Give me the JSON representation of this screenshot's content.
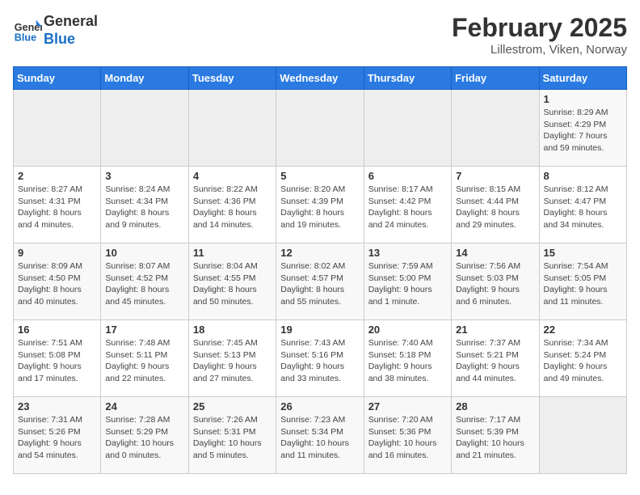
{
  "header": {
    "logo_line1": "General",
    "logo_line2": "Blue",
    "title": "February 2025",
    "subtitle": "Lillestrom, Viken, Norway"
  },
  "weekdays": [
    "Sunday",
    "Monday",
    "Tuesday",
    "Wednesday",
    "Thursday",
    "Friday",
    "Saturday"
  ],
  "weeks": [
    [
      {
        "day": "",
        "info": ""
      },
      {
        "day": "",
        "info": ""
      },
      {
        "day": "",
        "info": ""
      },
      {
        "day": "",
        "info": ""
      },
      {
        "day": "",
        "info": ""
      },
      {
        "day": "",
        "info": ""
      },
      {
        "day": "1",
        "info": "Sunrise: 8:29 AM\nSunset: 4:29 PM\nDaylight: 7 hours and 59 minutes."
      }
    ],
    [
      {
        "day": "2",
        "info": "Sunrise: 8:27 AM\nSunset: 4:31 PM\nDaylight: 8 hours and 4 minutes."
      },
      {
        "day": "3",
        "info": "Sunrise: 8:24 AM\nSunset: 4:34 PM\nDaylight: 8 hours and 9 minutes."
      },
      {
        "day": "4",
        "info": "Sunrise: 8:22 AM\nSunset: 4:36 PM\nDaylight: 8 hours and 14 minutes."
      },
      {
        "day": "5",
        "info": "Sunrise: 8:20 AM\nSunset: 4:39 PM\nDaylight: 8 hours and 19 minutes."
      },
      {
        "day": "6",
        "info": "Sunrise: 8:17 AM\nSunset: 4:42 PM\nDaylight: 8 hours and 24 minutes."
      },
      {
        "day": "7",
        "info": "Sunrise: 8:15 AM\nSunset: 4:44 PM\nDaylight: 8 hours and 29 minutes."
      },
      {
        "day": "8",
        "info": "Sunrise: 8:12 AM\nSunset: 4:47 PM\nDaylight: 8 hours and 34 minutes."
      }
    ],
    [
      {
        "day": "9",
        "info": "Sunrise: 8:09 AM\nSunset: 4:50 PM\nDaylight: 8 hours and 40 minutes."
      },
      {
        "day": "10",
        "info": "Sunrise: 8:07 AM\nSunset: 4:52 PM\nDaylight: 8 hours and 45 minutes."
      },
      {
        "day": "11",
        "info": "Sunrise: 8:04 AM\nSunset: 4:55 PM\nDaylight: 8 hours and 50 minutes."
      },
      {
        "day": "12",
        "info": "Sunrise: 8:02 AM\nSunset: 4:57 PM\nDaylight: 8 hours and 55 minutes."
      },
      {
        "day": "13",
        "info": "Sunrise: 7:59 AM\nSunset: 5:00 PM\nDaylight: 9 hours and 1 minute."
      },
      {
        "day": "14",
        "info": "Sunrise: 7:56 AM\nSunset: 5:03 PM\nDaylight: 9 hours and 6 minutes."
      },
      {
        "day": "15",
        "info": "Sunrise: 7:54 AM\nSunset: 5:05 PM\nDaylight: 9 hours and 11 minutes."
      }
    ],
    [
      {
        "day": "16",
        "info": "Sunrise: 7:51 AM\nSunset: 5:08 PM\nDaylight: 9 hours and 17 minutes."
      },
      {
        "day": "17",
        "info": "Sunrise: 7:48 AM\nSunset: 5:11 PM\nDaylight: 9 hours and 22 minutes."
      },
      {
        "day": "18",
        "info": "Sunrise: 7:45 AM\nSunset: 5:13 PM\nDaylight: 9 hours and 27 minutes."
      },
      {
        "day": "19",
        "info": "Sunrise: 7:43 AM\nSunset: 5:16 PM\nDaylight: 9 hours and 33 minutes."
      },
      {
        "day": "20",
        "info": "Sunrise: 7:40 AM\nSunset: 5:18 PM\nDaylight: 9 hours and 38 minutes."
      },
      {
        "day": "21",
        "info": "Sunrise: 7:37 AM\nSunset: 5:21 PM\nDaylight: 9 hours and 44 minutes."
      },
      {
        "day": "22",
        "info": "Sunrise: 7:34 AM\nSunset: 5:24 PM\nDaylight: 9 hours and 49 minutes."
      }
    ],
    [
      {
        "day": "23",
        "info": "Sunrise: 7:31 AM\nSunset: 5:26 PM\nDaylight: 9 hours and 54 minutes."
      },
      {
        "day": "24",
        "info": "Sunrise: 7:28 AM\nSunset: 5:29 PM\nDaylight: 10 hours and 0 minutes."
      },
      {
        "day": "25",
        "info": "Sunrise: 7:26 AM\nSunset: 5:31 PM\nDaylight: 10 hours and 5 minutes."
      },
      {
        "day": "26",
        "info": "Sunrise: 7:23 AM\nSunset: 5:34 PM\nDaylight: 10 hours and 11 minutes."
      },
      {
        "day": "27",
        "info": "Sunrise: 7:20 AM\nSunset: 5:36 PM\nDaylight: 10 hours and 16 minutes."
      },
      {
        "day": "28",
        "info": "Sunrise: 7:17 AM\nSunset: 5:39 PM\nDaylight: 10 hours and 21 minutes."
      },
      {
        "day": "",
        "info": ""
      }
    ]
  ]
}
